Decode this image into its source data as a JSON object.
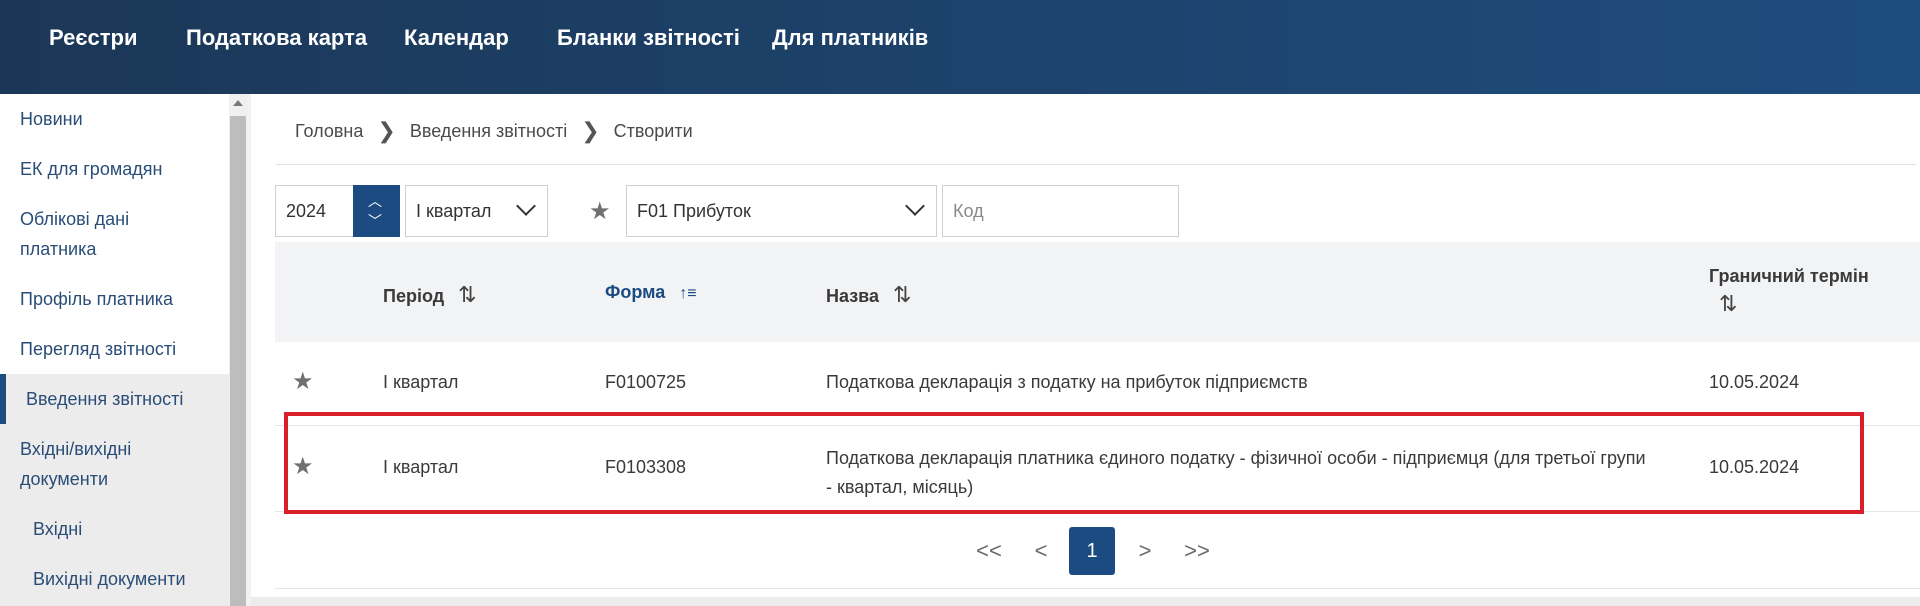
{
  "topnav": {
    "items": [
      "Реєстри",
      "Податкова карта",
      "Календар",
      "Бланки звітності",
      "Для платників"
    ]
  },
  "sidebar": {
    "items": [
      {
        "label": "Новини"
      },
      {
        "label": "ЕК для громадян"
      },
      {
        "label": "Облікові дані"
      },
      {
        "label": "платника"
      },
      {
        "label": "Профіль платника"
      },
      {
        "label": "Перегляд звітності"
      },
      {
        "label": "Введення звітності"
      },
      {
        "label": "Вхідні/вихідні"
      },
      {
        "label": "документи"
      },
      {
        "label": "Вхідні"
      },
      {
        "label": "Вихідні документи"
      }
    ],
    "active_index": 6
  },
  "breadcrumb": {
    "items": [
      "Головна",
      "Введення звітності",
      "Створити"
    ],
    "separator": "❯"
  },
  "filters": {
    "year": "2024",
    "quarter": "І квартал",
    "form": "F01 Прибуток",
    "code_placeholder": "Код"
  },
  "table": {
    "headers": {
      "period": "Період",
      "form": "Форма",
      "name": "Назва",
      "deadline_line1": "Граничний термін"
    },
    "sort_icons": {
      "period": "⇅",
      "form": "↑≡",
      "name": "⇅",
      "deadline": "⇅"
    },
    "rows": [
      {
        "period": "І квартал",
        "form": "F0100725",
        "name_line1": "Податкова декларація з податку на прибуток підприємств",
        "name_line2": "",
        "deadline": "10.05.2024"
      },
      {
        "period": "І квартал",
        "form": "F0103308",
        "name_line1": "Податкова декларація платника єдиного податку - фізичної особи - підприємця (для третьої групи",
        "name_line2": "- квартал, місяць)",
        "deadline": "10.05.2024"
      }
    ]
  },
  "pagination": {
    "first": "<<",
    "prev": "<",
    "current": "1",
    "next": ">",
    "last": ">>"
  },
  "colors": {
    "primary": "#1c4b82",
    "highlight": "#d8202a",
    "nav_bg": "#1d4169"
  }
}
